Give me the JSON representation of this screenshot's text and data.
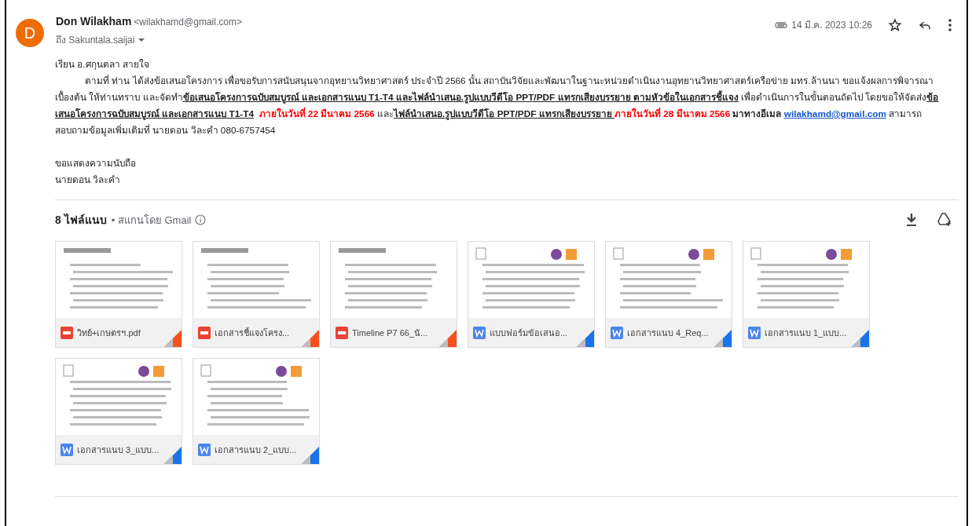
{
  "sender": {
    "initial": "D",
    "name": "Don Wilakham",
    "email": "<wilakhamd@gmail.com>",
    "to": "ถึง Sakuntala.saijai"
  },
  "date": "14 มี.ค. 2023 10:26",
  "greeting": "เรียน อ.ศกุนตลา  สายใจ",
  "paragraph": [
    {
      "kind": "plain",
      "text": "ตามที่ ท่าน ได้ส่งข้อเสนอโครงการ เพื่อขอรับการสนับสนุนจากอุทยานวิทยาศาสตร์ ประจำปี 2566 นั้น สถาบันวิจัยและพัฒนาในฐานะหน่วยดำเนินงานอุทยานวิทยาศาสตร์เครือข่าย มทร.ล้านนา ขอแจ้งผลการพิจารณาเบื้องต้น ให้ท่านทราบ และจัดทำ"
    },
    {
      "kind": "emph",
      "text": "ข้อเสนอโครงการฉบับสมบูรณ์ และเอกสารแนบ T1-T4 และไฟล์นำเสนอ.รูปแบบวีดีโอ PPT/PDF แทรกเสียงบรรยาย ตามหัวข้อในเอกสารชี้แจง"
    },
    {
      "kind": "plain",
      "text": " เพื่อดำเนินการในขั้นตอนถัดไป โดยขอให้จัดส่ง"
    },
    {
      "kind": "emph",
      "text": "ข้อเสนอโครงการฉบับสมบูรณ์ และเอกสารแนบ T1-T4"
    },
    {
      "kind": "deadline",
      "text": "  ภายในวันที่ 22 มีนาคม 2566"
    },
    {
      "kind": "plain",
      "text": " และ"
    },
    {
      "kind": "emph",
      "text": "ไฟล์นำเสนอ.รูปแบบวีดีโอ PPT/PDF แทรกเสียงบรรยาย "
    },
    {
      "kind": "deadline",
      "text": "ภายในวันที่ 28 มีนาคม 2566"
    },
    {
      "kind": "bold",
      "text": " มาทางอีเมล "
    },
    {
      "kind": "link",
      "text": "wilakhamd@gmail.com"
    },
    {
      "kind": "plain",
      "text": " สามารถสอบถามข้อมูลเพิ่มเติมที่ นายดอน วิละคำ 080-6757454"
    }
  ],
  "closing": "ขอแสดงความนับถือ",
  "signature": "นายดอน วิละคำ",
  "attachments_header": {
    "count": "8 ไฟล์แนบ",
    "scan": "• สแกนโดย Gmail"
  },
  "attachments": [
    {
      "kind": "pdf",
      "name": "วิทย์+เกษตรฯ.pdf"
    },
    {
      "kind": "pdf",
      "name": "เอกสารชี้แจงโครง..."
    },
    {
      "kind": "pdf",
      "name": "Timeline P7 66_นั..."
    },
    {
      "kind": "word",
      "name": "แบบฟอร์มข้อเสนอ..."
    },
    {
      "kind": "word",
      "name": "เอกสารแนบ 4_Req..."
    },
    {
      "kind": "word",
      "name": "เอกสารแนบ 1_แบบ..."
    },
    {
      "kind": "word",
      "name": "เอกสารแนบ 3_แบบ..."
    },
    {
      "kind": "word",
      "name": "เอกสารแนบ 2_แบบ..."
    }
  ]
}
